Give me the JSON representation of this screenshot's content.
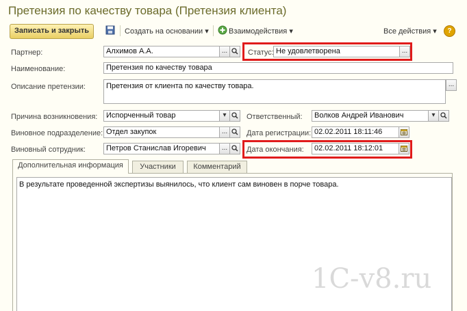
{
  "window": {
    "title": "Претензия по качеству товара (Претензия клиента)"
  },
  "toolbar": {
    "save_close": "Записать и закрыть",
    "create_based": "Создать на основании",
    "interactions": "Взаимодействия",
    "all_actions": "Все действия",
    "help": "?"
  },
  "form": {
    "partner_label": "Партнер:",
    "partner_value": "Алхимов А.А.",
    "status_label": "Статус:",
    "status_value": "Не удовлетворена",
    "name_label": "Наименование:",
    "name_value": "Претензия по качеству товара",
    "description_label": "Описание претензии:",
    "description_value": "Претензия от клиента по качеству товара.",
    "cause_label": "Причина возникновения:",
    "cause_value": "Испорченный товар",
    "responsible_label": "Ответственный:",
    "responsible_value": "Волков Андрей Иванович",
    "dept_label": "Виновное подразделение:",
    "dept_value": "Отдел закупок",
    "reg_date_label": "Дата регистрации:",
    "reg_date_value": "02.02.2011 18:11:46",
    "employee_label": "Виновный сотрудник:",
    "employee_value": "Петров Станислав Игоревич",
    "end_date_label": "Дата окончания:",
    "end_date_value": "02.02.2011 18:12:01"
  },
  "tabs": [
    {
      "label": "Дополнительная информация",
      "active": true
    },
    {
      "label": "Участники",
      "active": false
    },
    {
      "label": "Комментарий",
      "active": false
    }
  ],
  "additional_info": "В результате проведенной экспертизы выянилось, что клиент сам виновен в порче товара.",
  "watermark": "1C-v8.ru",
  "colors": {
    "highlight": "#e01b1b",
    "title": "#6b6b2b",
    "save_button": "#e9cf63"
  }
}
